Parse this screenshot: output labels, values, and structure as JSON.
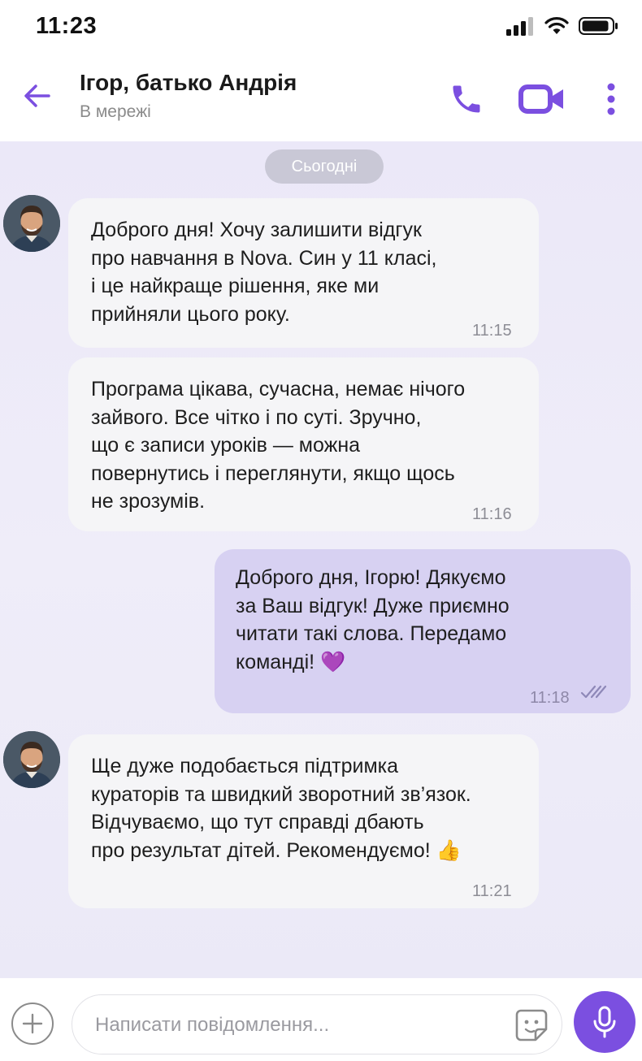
{
  "status_bar": {
    "time": "11:23"
  },
  "header": {
    "contact_name": "Ігор, батько Андрія",
    "contact_status": "В мережі"
  },
  "chat": {
    "date_label": "Сьогодні",
    "messages": [
      {
        "direction": "incoming",
        "text": "Доброго дня! Хочу залишити відгук\nпро навчання в Nova. Син у 11 класі,\nі це найкраще рішення, яке ми\nприйняли цього року.",
        "time": "11:15"
      },
      {
        "direction": "incoming",
        "text": "Програма цікава, сучасна, немає нічого\nзайвого. Все чітко і по суті. Зручно,\nщо є записи уроків — можна\nповернутись і переглянути, якщо щось\nне зрозумів.",
        "time": "11:16"
      },
      {
        "direction": "outgoing",
        "text": "Доброго дня, Ігорю! Дякуємо\nза Ваш відгук! Дуже приємно\nчитати такі слова. Передамо\nкоманді! 💜",
        "time": "11:18",
        "read": true
      },
      {
        "direction": "incoming",
        "text": "Ще дуже подобається підтримка\nкураторів та швидкий зворотний зв’язок.\nВідчуваємо, що тут справді дбають\nпро результат дітей. Рекомендуємо! 👍",
        "time": "11:21"
      }
    ]
  },
  "composer": {
    "placeholder": "Написати повідомлення..."
  },
  "icons": {
    "back": "arrow-left-icon",
    "call": "phone-icon",
    "video": "video-camera-icon",
    "more": "more-vertical-icon",
    "attach": "plus-icon",
    "sticker": "sticker-icon",
    "mic": "microphone-icon",
    "read_receipt": "double-check-icon"
  },
  "colors": {
    "accent": "#7b4fe0",
    "outgoing_bubble": "#d7d1f2",
    "incoming_bubble": "#f5f5f7",
    "chat_background": "#ebe8f8"
  }
}
